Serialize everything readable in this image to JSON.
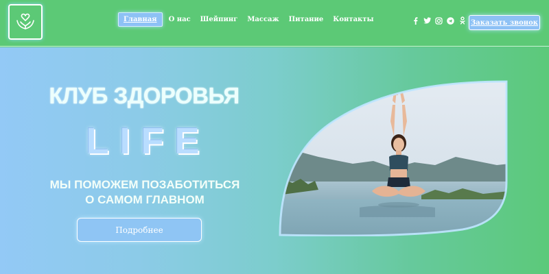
{
  "header": {
    "logo_icon": "hands-heart-icon",
    "nav": [
      {
        "label": "Главная",
        "active": true
      },
      {
        "label": "О нас",
        "active": false
      },
      {
        "label": "Шейпинг",
        "active": false
      },
      {
        "label": "Массаж",
        "active": false
      },
      {
        "label": "Питание",
        "active": false
      },
      {
        "label": "Контакты",
        "active": false
      }
    ],
    "social_icons": [
      "facebook-icon",
      "twitter-icon",
      "instagram-icon",
      "telegram-icon",
      "odnoklassniki-icon"
    ],
    "call_button": "Заказать звонок"
  },
  "hero": {
    "title": "КЛУБ ЗДОРОВЬЯ",
    "brand": "LIFE",
    "subtitle_line1": "МЫ ПОМОЖЕМ ПОЗАБОТИТЬСЯ",
    "subtitle_line2": "О САМОМ ГЛАВНОМ",
    "more_button": "Подробнее",
    "image": "woman-yoga-pose-by-sea-photo"
  },
  "colors": {
    "header_bg": "#5cc976",
    "accent_blue": "#8dc1f5",
    "hero_gradient_start": "#93c9f6",
    "hero_gradient_end": "#5cc97a"
  }
}
